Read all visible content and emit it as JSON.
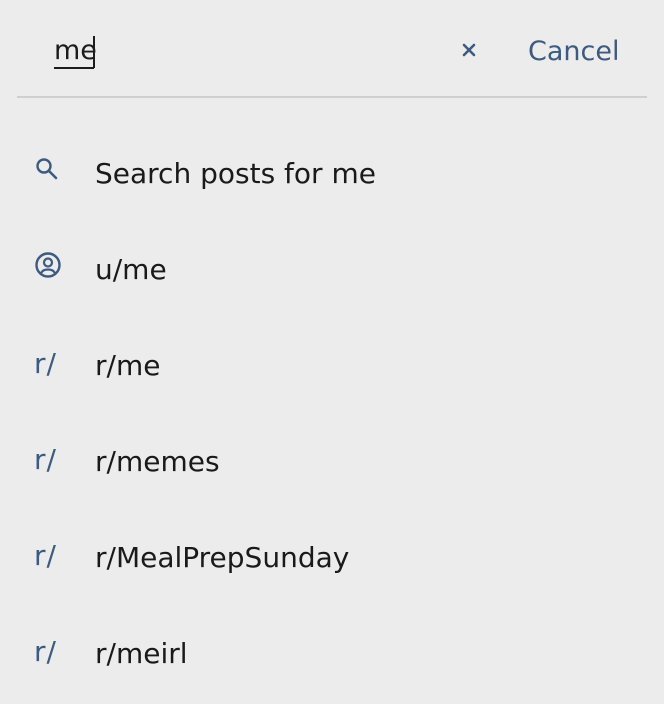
{
  "search": {
    "value": "me",
    "cancel_label": "Cancel"
  },
  "results": [
    {
      "icon": "search-icon",
      "label": "Search posts for me"
    },
    {
      "icon": "user-icon",
      "label": "u/me"
    },
    {
      "icon": "subreddit-icon",
      "prefix": "r/",
      "label": "r/me"
    },
    {
      "icon": "subreddit-icon",
      "prefix": "r/",
      "label": "r/memes"
    },
    {
      "icon": "subreddit-icon",
      "prefix": "r/",
      "label": "r/MealPrepSunday"
    },
    {
      "icon": "subreddit-icon",
      "prefix": "r/",
      "label": "r/meirl"
    }
  ],
  "colors": {
    "background": "#ececec",
    "accent": "#3d5a80",
    "text": "#1a1a1a",
    "divider": "#cfcfcf"
  }
}
